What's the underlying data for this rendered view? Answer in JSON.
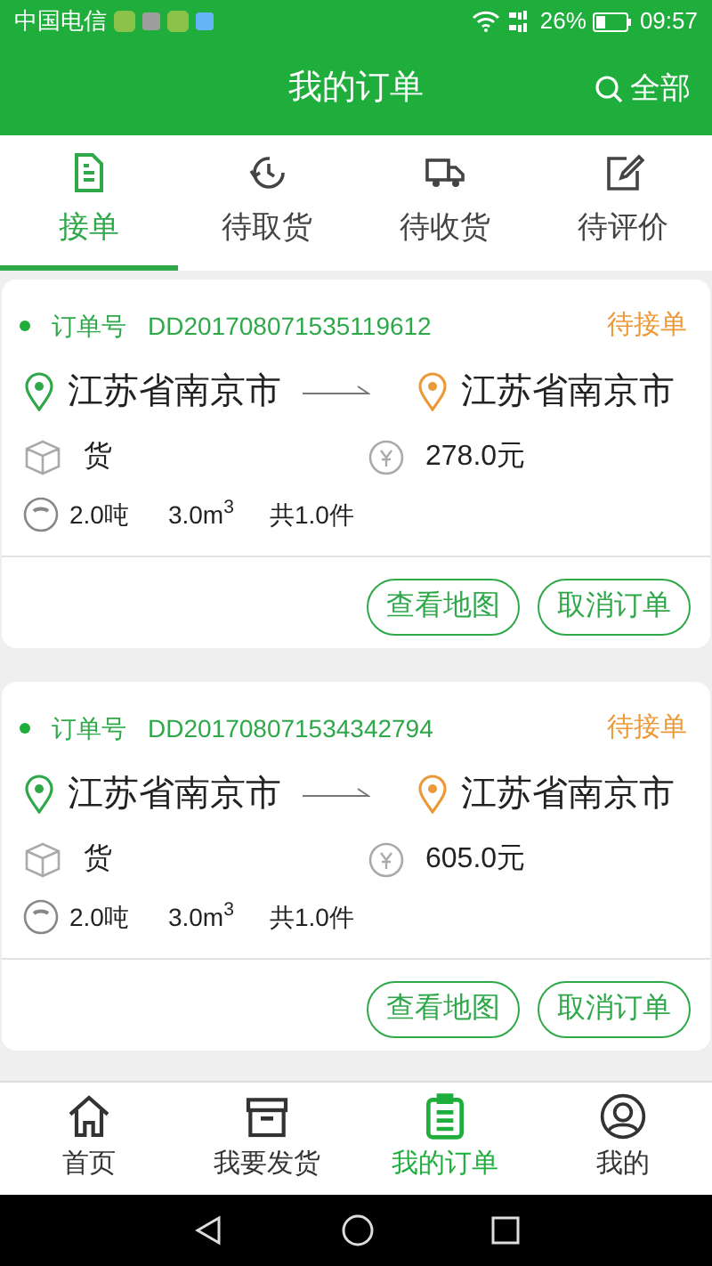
{
  "status_bar": {
    "carrier": "中国电信",
    "battery": "26%",
    "time": "09:57"
  },
  "header": {
    "title": "我的订单",
    "action": "全部"
  },
  "tabs": [
    {
      "label": "接单",
      "selected": true
    },
    {
      "label": "待取货",
      "selected": false
    },
    {
      "label": "待收货",
      "selected": false
    },
    {
      "label": "待评价",
      "selected": false
    }
  ],
  "orders": [
    {
      "order_label": "订单号",
      "order_no": "DD201708071535119612",
      "status": "待接单",
      "from": "江苏省南京市",
      "to": "江苏省南京市",
      "goods": "货",
      "price": "278.0元",
      "weight": "2.0吨",
      "volume": "3.0m$^{3}$",
      "count": "共1.0件",
      "buttons": [
        "查看地图",
        "取消订单"
      ]
    },
    {
      "order_label": "订单号",
      "order_no": "DD201708071534342794",
      "status": "待接单",
      "from": "江苏省南京市",
      "to": "江苏省南京市",
      "goods": "货",
      "price": "605.0元",
      "weight": "2.0吨",
      "volume": "3.0m$^{3}$",
      "count": "共1.0件",
      "buttons": [
        "查看地图",
        "取消订单"
      ]
    }
  ],
  "bottom_nav": [
    {
      "label": "首页",
      "selected": false
    },
    {
      "label": "我要发货",
      "selected": false
    },
    {
      "label": "我的订单",
      "selected": true
    },
    {
      "label": "我的",
      "selected": false
    }
  ]
}
